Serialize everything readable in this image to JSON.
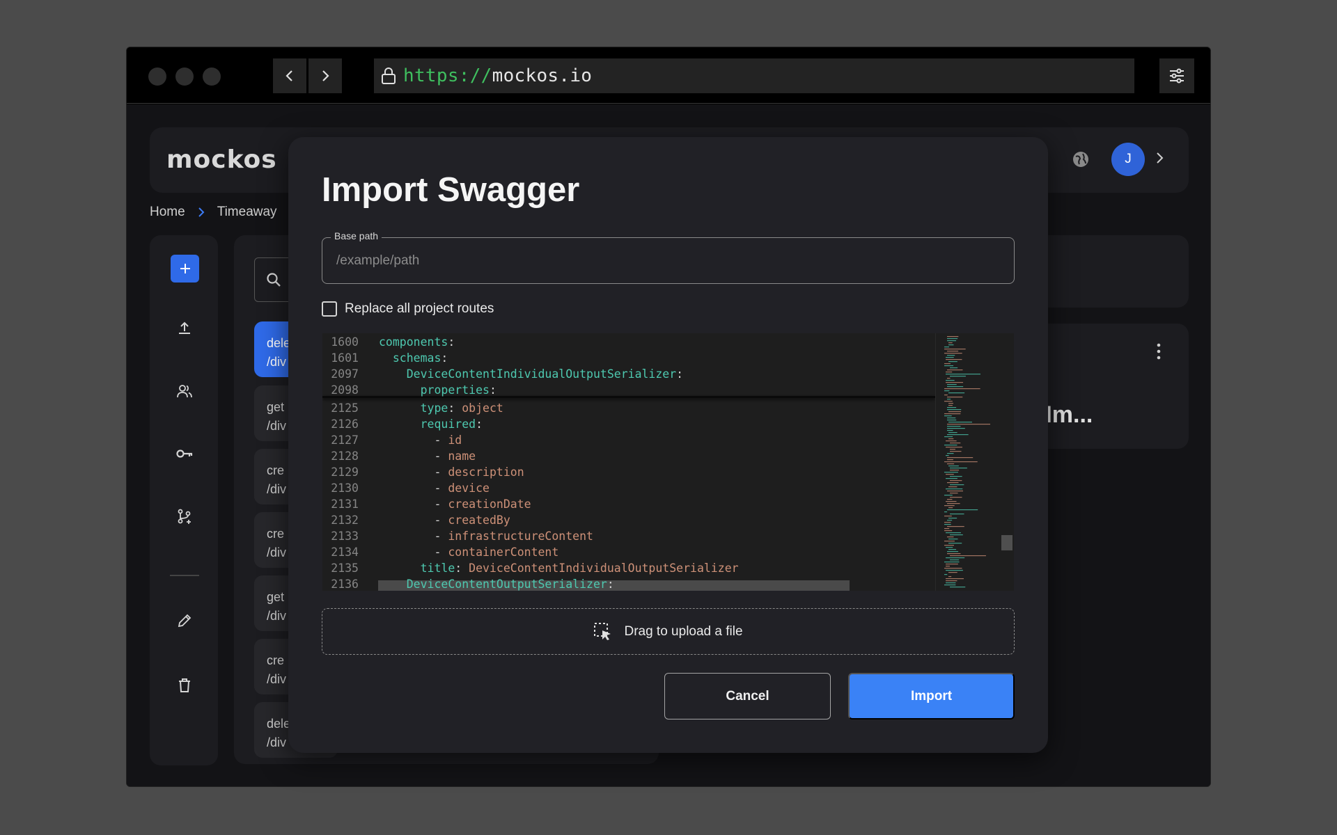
{
  "browser": {
    "url_protocol": "https://",
    "url_host": "mockos.io"
  },
  "app": {
    "logo_text": "mockos",
    "avatar_initial": "J",
    "breadcrumb": [
      "Home",
      "Timeaway"
    ],
    "sidebar_icons": [
      "plus-icon",
      "upload-icon",
      "users-icon",
      "key-icon",
      "branch-icon",
      "pencil-icon",
      "trash-icon"
    ],
    "routes": [
      {
        "method": "dele",
        "path": "/div",
        "active": true
      },
      {
        "method": "get",
        "path": "/div",
        "active": false
      },
      {
        "method": "cre",
        "path": "/div",
        "active": false
      },
      {
        "method": "cre",
        "path": "/div",
        "active": false
      },
      {
        "method": "get",
        "path": "/div",
        "active": false
      },
      {
        "method": "cre",
        "path": "/div",
        "active": false
      },
      {
        "method": "dele",
        "path": "/div",
        "active": false
      }
    ],
    "right_title": "len - Im..."
  },
  "modal": {
    "title": "Import Swagger",
    "base_path_label": "Base path",
    "base_path_placeholder": "/example/path",
    "base_path_value": "",
    "replace_label": "Replace all project routes",
    "replace_checked": false,
    "upload_text": "Drag to upload a file",
    "cancel_label": "Cancel",
    "import_label": "Import",
    "accent_color": "#3a82f6"
  },
  "editor": {
    "sticky_lines": [
      {
        "ln": "1600",
        "indent": 0,
        "key": "components",
        "value": ""
      },
      {
        "ln": "1601",
        "indent": 2,
        "key": "schemas",
        "value": ""
      },
      {
        "ln": "2097",
        "indent": 4,
        "key": "DeviceContentIndividualOutputSerializer",
        "value": ""
      },
      {
        "ln": "2098",
        "indent": 6,
        "key": "properties",
        "value": ""
      }
    ],
    "lines": [
      {
        "ln": "2125",
        "indent": 6,
        "key": "type",
        "value": "object"
      },
      {
        "ln": "2126",
        "indent": 6,
        "key": "required",
        "value": ""
      },
      {
        "ln": "2127",
        "indent": 8,
        "item": "id"
      },
      {
        "ln": "2128",
        "indent": 8,
        "item": "name"
      },
      {
        "ln": "2129",
        "indent": 8,
        "item": "description"
      },
      {
        "ln": "2130",
        "indent": 8,
        "item": "device"
      },
      {
        "ln": "2131",
        "indent": 8,
        "item": "creationDate"
      },
      {
        "ln": "2132",
        "indent": 8,
        "item": "createdBy"
      },
      {
        "ln": "2133",
        "indent": 8,
        "item": "infrastructureContent"
      },
      {
        "ln": "2134",
        "indent": 8,
        "item": "containerContent"
      },
      {
        "ln": "2135",
        "indent": 6,
        "key": "title",
        "value": "DeviceContentIndividualOutputSerializer"
      },
      {
        "ln": "2136",
        "indent": 4,
        "key": "DeviceContentOutputSerializer",
        "value": ""
      }
    ]
  }
}
